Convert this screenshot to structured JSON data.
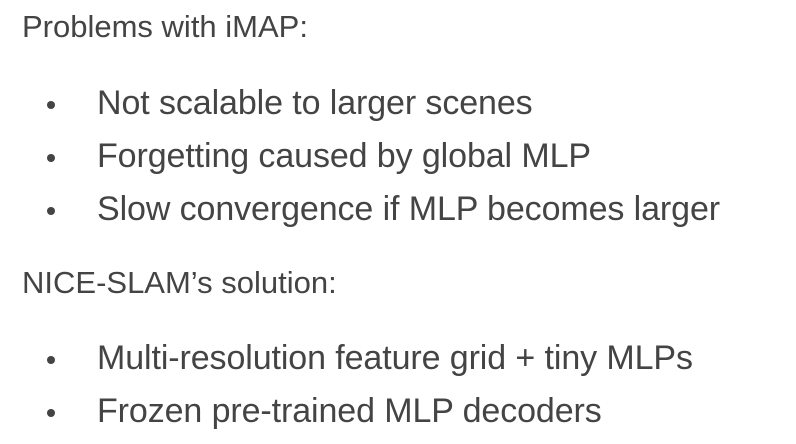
{
  "section1": {
    "heading": "Problems with iMAP:",
    "bullets": [
      "Not scalable to larger scenes",
      "Forgetting caused by global MLP",
      "Slow convergence if MLP becomes larger"
    ]
  },
  "section2": {
    "heading": "NICE-SLAM’s solution:",
    "bullets": [
      "Multi-resolution feature grid + tiny MLPs",
      "Frozen pre-trained MLP decoders"
    ]
  }
}
